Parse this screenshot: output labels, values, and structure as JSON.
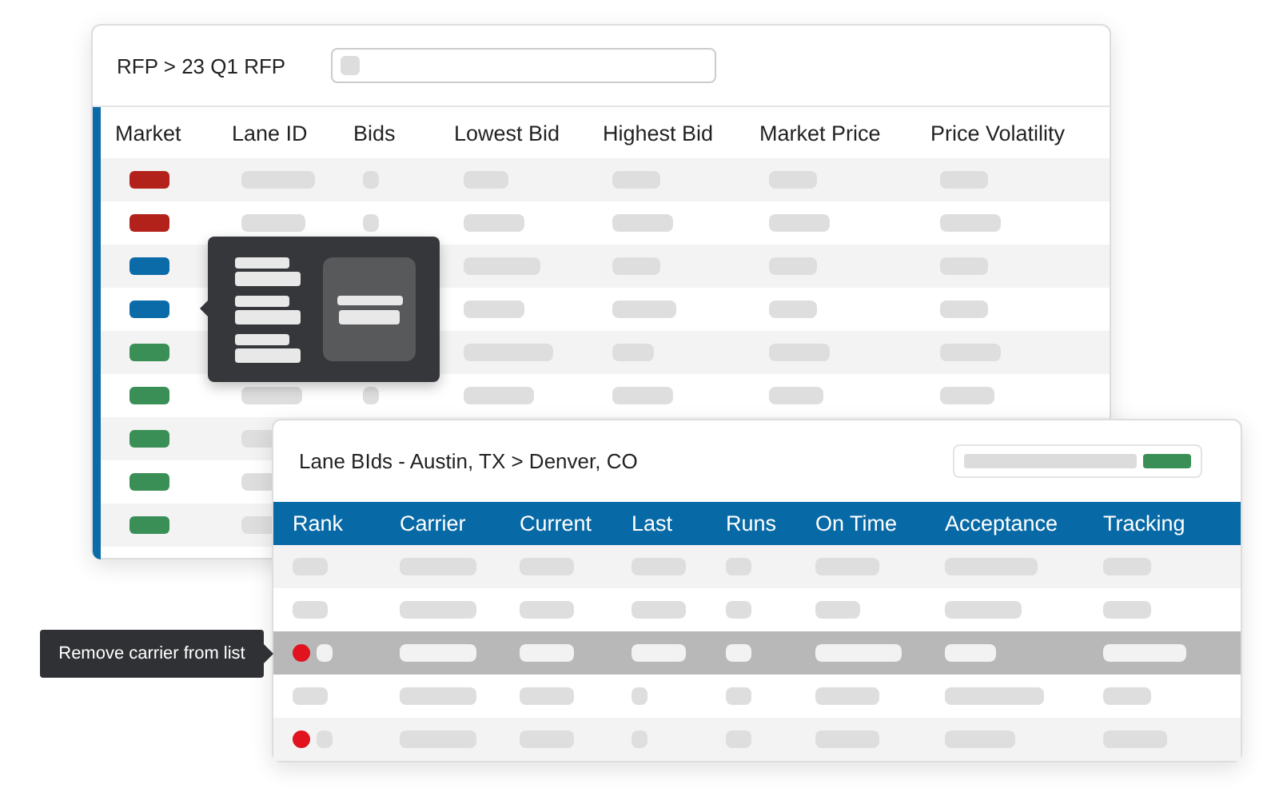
{
  "rfp_window": {
    "breadcrumb": "RFP > 23 Q1 RFP",
    "columns": [
      "Market",
      "Lane ID",
      "Bids",
      "Lowest Bid",
      "Highest Bid",
      "Market Price",
      "Price Volatility"
    ],
    "rows": [
      {
        "color": "#b3211b"
      },
      {
        "color": "#b3211b"
      },
      {
        "color": "#0b6aa8"
      },
      {
        "color": "#0b6aa8"
      },
      {
        "color": "#3a8f56"
      },
      {
        "color": "#3a8f56"
      },
      {
        "color": "#3a8f56"
      },
      {
        "color": "#3a8f56"
      },
      {
        "color": "#3a8f56"
      }
    ]
  },
  "lane_bids_window": {
    "title": "Lane BIds - Austin, TX > Denver, CO",
    "columns": [
      "Rank",
      "Carrier",
      "Current",
      "Last",
      "Runs",
      "On Time",
      "Acceptance",
      "Tracking"
    ],
    "rows": [
      {
        "flagged": false,
        "selected": false
      },
      {
        "flagged": false,
        "selected": false
      },
      {
        "flagged": true,
        "selected": true
      },
      {
        "flagged": false,
        "selected": false
      },
      {
        "flagged": true,
        "selected": false
      }
    ],
    "row_tooltip": "Remove carrier from list"
  }
}
